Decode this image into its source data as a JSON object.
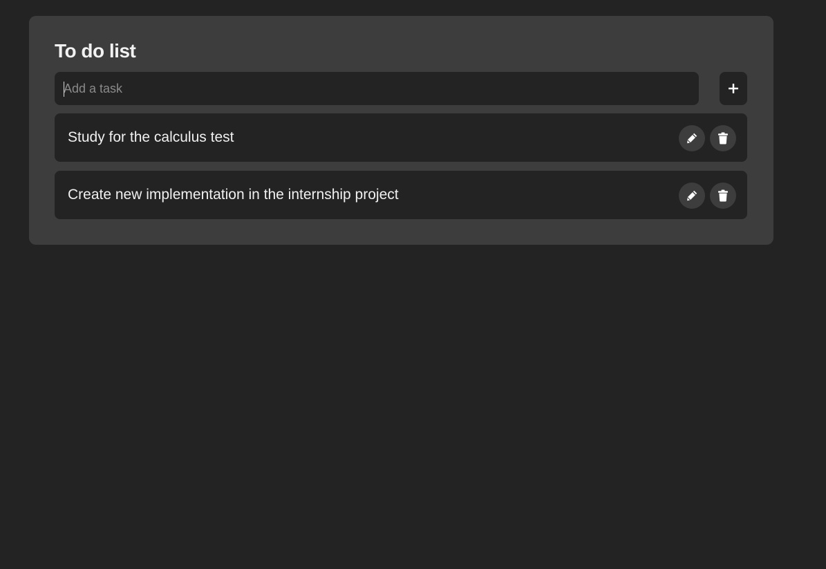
{
  "app": {
    "title": "To do list"
  },
  "input": {
    "placeholder": "Add a task",
    "value": "",
    "add_icon": "plus-icon"
  },
  "tasks": [
    {
      "text": "Study for the calculus test",
      "edit_icon": "pencil-icon",
      "delete_icon": "trash-icon"
    },
    {
      "text": "Create new implementation in the internship project",
      "edit_icon": "pencil-icon",
      "delete_icon": "trash-icon"
    }
  ],
  "colors": {
    "page_background": "#232323",
    "card_background": "#3d3d3d",
    "item_background": "#232323",
    "text": "#f0f0f0",
    "placeholder": "#8a8a8a"
  }
}
